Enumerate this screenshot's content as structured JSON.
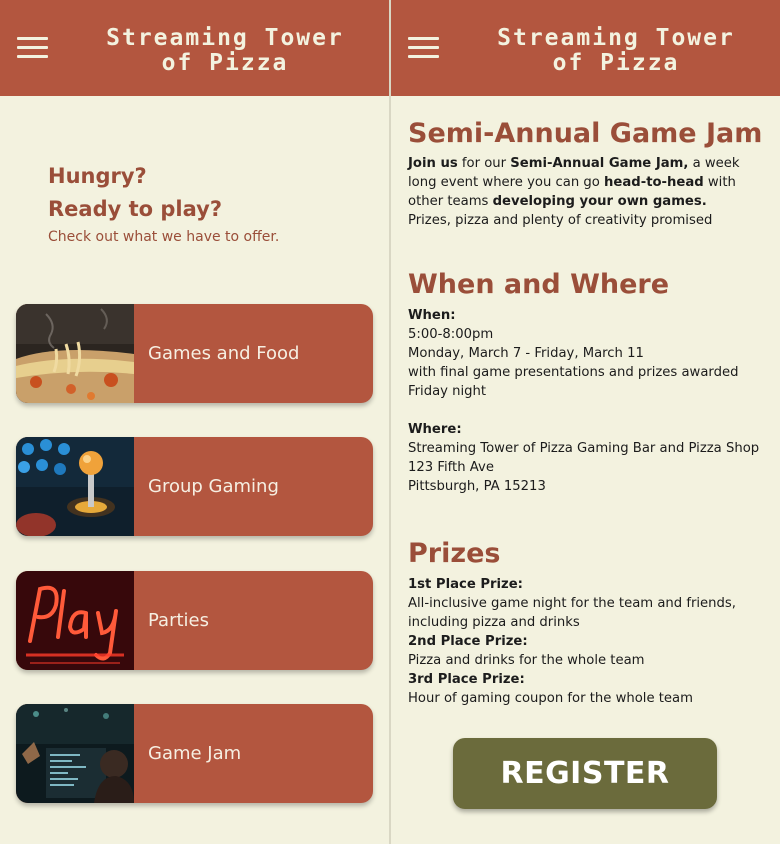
{
  "brand": {
    "line1": "Streaming Tower",
    "line2": "of Pizza"
  },
  "home": {
    "hero": {
      "line1": "Hungry?",
      "line2": "Ready to play?",
      "subtitle": "Check out what we have to offer."
    },
    "cards": [
      {
        "label": "Games and Food",
        "image": "pizza-photo"
      },
      {
        "label": "Group Gaming",
        "image": "arcade-joystick-photo"
      },
      {
        "label": "Parties",
        "image": "neon-play-sign-photo"
      },
      {
        "label": "Game Jam",
        "image": "developer-desk-photo"
      }
    ]
  },
  "jam": {
    "title": "Semi-Annual Game Jam",
    "intro": {
      "s1": "Join us",
      "s2": " for our ",
      "s3": "Semi-Annual Game Jam,",
      "s4": " a week long event where you can go ",
      "s5": "head-to-head",
      "s6": " with other teams ",
      "s7": "developing your own games.",
      "s8": "Prizes, pizza and plenty of creativity promised"
    },
    "when_where": {
      "title": "When and Where",
      "when_label": "When:",
      "when_lines": [
        "5:00-8:00pm",
        "Monday, March 7 - Friday, March 11",
        "with final game presentations and prizes awarded Friday night"
      ],
      "where_label": "Where:",
      "where_lines": [
        "Streaming Tower of Pizza Gaming Bar and Pizza Shop",
        "123 Fifth Ave",
        "Pittsburgh, PA 15213"
      ]
    },
    "prizes": {
      "title": "Prizes",
      "items": [
        {
          "label": "1st Place Prize:",
          "text": "All-inclusive game night for the team and friends, including pizza and drinks"
        },
        {
          "label": "2nd Place Prize:",
          "text": "Pizza and drinks for the whole team"
        },
        {
          "label": "3rd Place Prize:",
          "text": "Hour of gaming coupon for the whole team"
        }
      ]
    },
    "register_label": "REGISTER"
  },
  "colors": {
    "header": "#b3563f",
    "background": "#f3f2df",
    "heading": "#9a4e39",
    "card": "#b3563f",
    "register_button": "#6b6b3c"
  }
}
